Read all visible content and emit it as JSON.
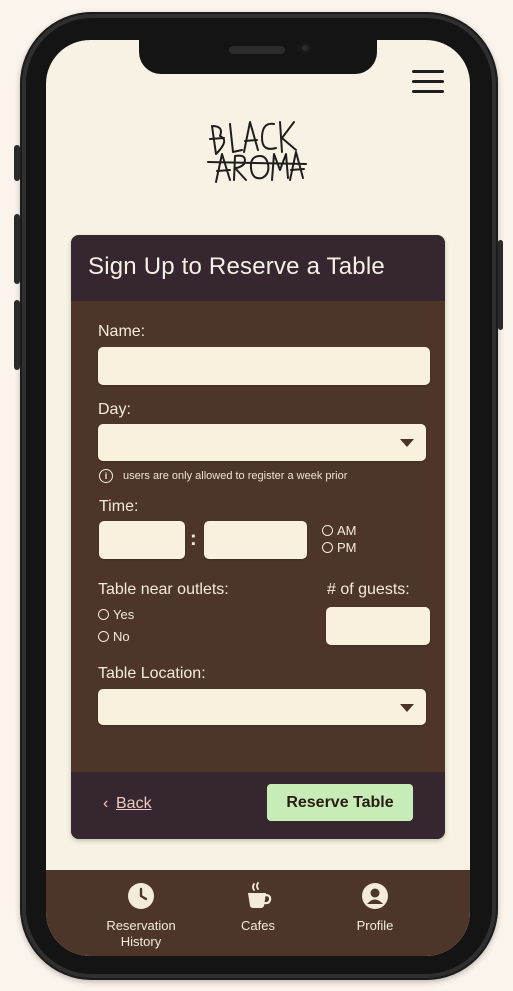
{
  "app": {
    "logo_text": [
      "BLACK",
      "AROMA"
    ]
  },
  "form": {
    "title": "Sign Up to Reserve a Table",
    "name_label": "Name:",
    "name_value": "",
    "day_label": "Day:",
    "day_selected": "",
    "day_note": "users are only allowed to register a week prior",
    "time_label": "Time:",
    "time_hour": "",
    "time_minute": "",
    "time_separator": ":",
    "am_label": "AM",
    "pm_label": "PM",
    "outlets_label": "Table near outlets:",
    "yes_label": "Yes",
    "no_label": "No",
    "guests_label": "# of guests:",
    "guests_value": "",
    "location_label": "Table Location:",
    "location_selected": ""
  },
  "footer": {
    "back_label": "Back",
    "reserve_label": "Reserve Table"
  },
  "nav": {
    "items": [
      {
        "label": "Reservation History",
        "icon": "clock-icon"
      },
      {
        "label": "Cafes",
        "icon": "coffee-cup-icon"
      },
      {
        "label": "Profile",
        "icon": "user-icon"
      }
    ]
  },
  "colors": {
    "screen_bg": "#f7f2e3",
    "card_bg": "#4e3529",
    "header_bg": "#35262f",
    "field_bg": "#f7f1dd",
    "accent_button": "#c8ecb8",
    "back_link": "#f0c9c2"
  }
}
